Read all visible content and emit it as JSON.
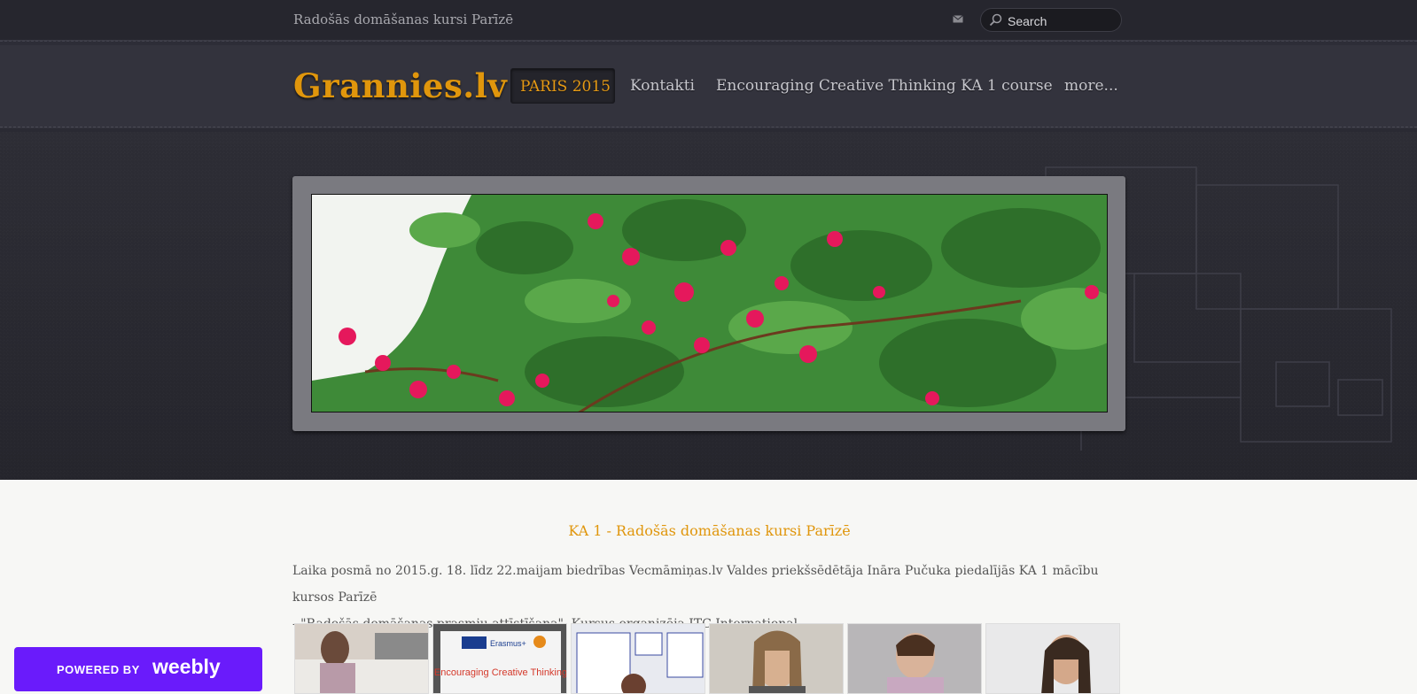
{
  "header": {
    "tagline": "Radošās domāšanas kursi Parīzē",
    "mail_icon": "mail-icon",
    "search_placeholder": "Search"
  },
  "nav": {
    "logo": "Grannies.lv",
    "items": [
      {
        "label": "PARIS 2015",
        "active": true
      },
      {
        "label": "Kontakti",
        "active": false
      },
      {
        "label": "Encouraging Creative Thinking KA 1 course",
        "active": false
      },
      {
        "label": "more...",
        "active": false
      }
    ]
  },
  "content": {
    "heading": "KA 1 - Radošās domāšanas kursi Parīzē",
    "paragraph_line1": "Laika posmā no  2015.g. 18. līdz 22.maijam biedrības Vecmāmiņas.lv Valdes priekšsēdētāja Ināra Pučuka piedalījās KA 1 mācību kursos Parīzē",
    "paragraph_line2": "-  \"Radošās domāšanas prasmju attīstīšana\". Kursus organizēja ITC International.",
    "thumbnail_texts": {
      "erasmus": "Erasmus+",
      "thumb2_caption": "Encouraging Creative Thinking"
    }
  },
  "badge": {
    "powered_by": "POWERED BY",
    "brand": "weebly"
  },
  "colors": {
    "accent": "#e0960c",
    "topbar": "#26262e",
    "navbar": "#33333d",
    "badge": "#6a1bfb"
  }
}
